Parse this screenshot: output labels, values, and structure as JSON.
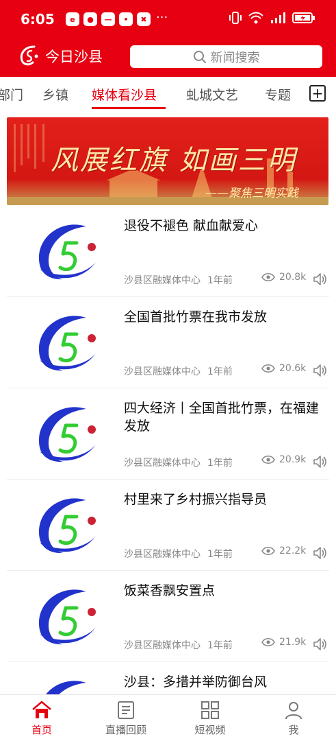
{
  "status": {
    "time": "6:05",
    "apps": [
      "e",
      "●",
      "—",
      "•",
      "✖"
    ],
    "more": "···"
  },
  "header": {
    "title": "今日沙县",
    "search_placeholder": "新闻搜索"
  },
  "tabs": [
    {
      "label": "部门"
    },
    {
      "label": "乡镇"
    },
    {
      "label": "媒体看沙县"
    },
    {
      "label": "虬城文艺"
    },
    {
      "label": "专题"
    }
  ],
  "banner": {
    "text_main": "风展红旗 如画三明",
    "text_sub": "——聚焦三明实践"
  },
  "news": [
    {
      "title": "退役不褪色  献血献爱心",
      "source": "沙县区融媒体中心",
      "time": "1年前",
      "views": "20.8k"
    },
    {
      "title": "全国首批竹票在我市发放",
      "source": "沙县区融媒体中心",
      "time": "1年前",
      "views": "20.6k"
    },
    {
      "title": "四大经济丨全国首批竹票，在福建发放",
      "source": "沙县区融媒体中心",
      "time": "1年前",
      "views": "20.9k"
    },
    {
      "title": "村里来了乡村振兴指导员",
      "source": "沙县区融媒体中心",
      "time": "1年前",
      "views": "22.2k"
    },
    {
      "title": "饭菜香飘安置点",
      "source": "沙县区融媒体中心",
      "time": "1年前",
      "views": "21.9k"
    },
    {
      "title": "沙县：多措并举防御台风",
      "source": "",
      "time": "",
      "views": ""
    }
  ],
  "nav": [
    {
      "label": "首页"
    },
    {
      "label": "直播回顾"
    },
    {
      "label": "短视频"
    },
    {
      "label": "我"
    }
  ],
  "colors": {
    "brand": "#e60012"
  }
}
